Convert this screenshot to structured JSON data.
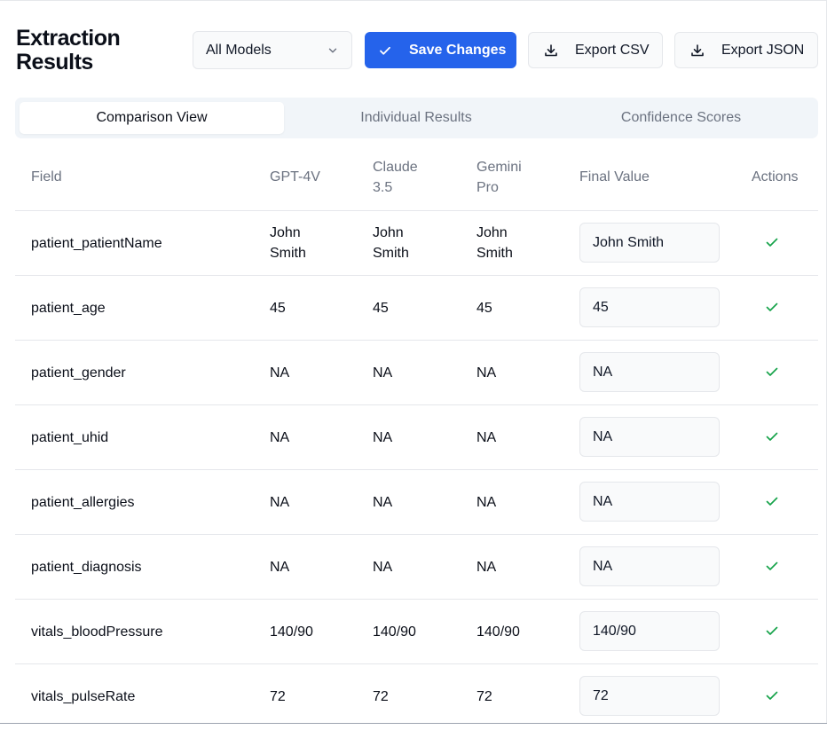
{
  "header": {
    "title_line1": "Extraction",
    "title_line2": "Results",
    "model_select": {
      "value": "All Models",
      "icon": "chevron-down-icon"
    },
    "save_label": "Save Changes",
    "export_csv_label": "Export CSV",
    "export_json_label": "Export JSON"
  },
  "tabs": [
    {
      "label": "Comparison View",
      "active": true
    },
    {
      "label": "Individual Results",
      "active": false
    },
    {
      "label": "Confidence Scores",
      "active": false
    }
  ],
  "table": {
    "headers": {
      "field": "Field",
      "gpt": "GPT-4V",
      "claude_l1": "Claude",
      "claude_l2": "3.5",
      "gemini_l1": "Gemini",
      "gemini_l2": "Pro",
      "final": "Final Value",
      "actions": "Actions"
    },
    "rows": [
      {
        "field": "patient_patientName",
        "gpt": [
          "John",
          "Smith"
        ],
        "claude": [
          "John",
          "Smith"
        ],
        "gemini": [
          "John",
          "Smith"
        ],
        "final": "John Smith"
      },
      {
        "field": "patient_age",
        "gpt": [
          "45"
        ],
        "claude": [
          "45"
        ],
        "gemini": [
          "45"
        ],
        "final": "45"
      },
      {
        "field": "patient_gender",
        "gpt": [
          "NA"
        ],
        "claude": [
          "NA"
        ],
        "gemini": [
          "NA"
        ],
        "final": "NA"
      },
      {
        "field": "patient_uhid",
        "gpt": [
          "NA"
        ],
        "claude": [
          "NA"
        ],
        "gemini": [
          "NA"
        ],
        "final": "NA"
      },
      {
        "field": "patient_allergies",
        "gpt": [
          "NA"
        ],
        "claude": [
          "NA"
        ],
        "gemini": [
          "NA"
        ],
        "final": "NA"
      },
      {
        "field": "patient_diagnosis",
        "gpt": [
          "NA"
        ],
        "claude": [
          "NA"
        ],
        "gemini": [
          "NA"
        ],
        "final": "NA"
      },
      {
        "field": "vitals_bloodPressure",
        "gpt": [
          "140/90"
        ],
        "claude": [
          "140/90"
        ],
        "gemini": [
          "140/90"
        ],
        "final": "140/90"
      },
      {
        "field": "vitals_pulseRate",
        "gpt": [
          "72"
        ],
        "claude": [
          "72"
        ],
        "gemini": [
          "72"
        ],
        "final": "72"
      }
    ],
    "action_icon": "check-icon"
  },
  "colors": {
    "primary": "#2563eb",
    "check": "#16a34a",
    "muted_text": "#6b7280"
  }
}
